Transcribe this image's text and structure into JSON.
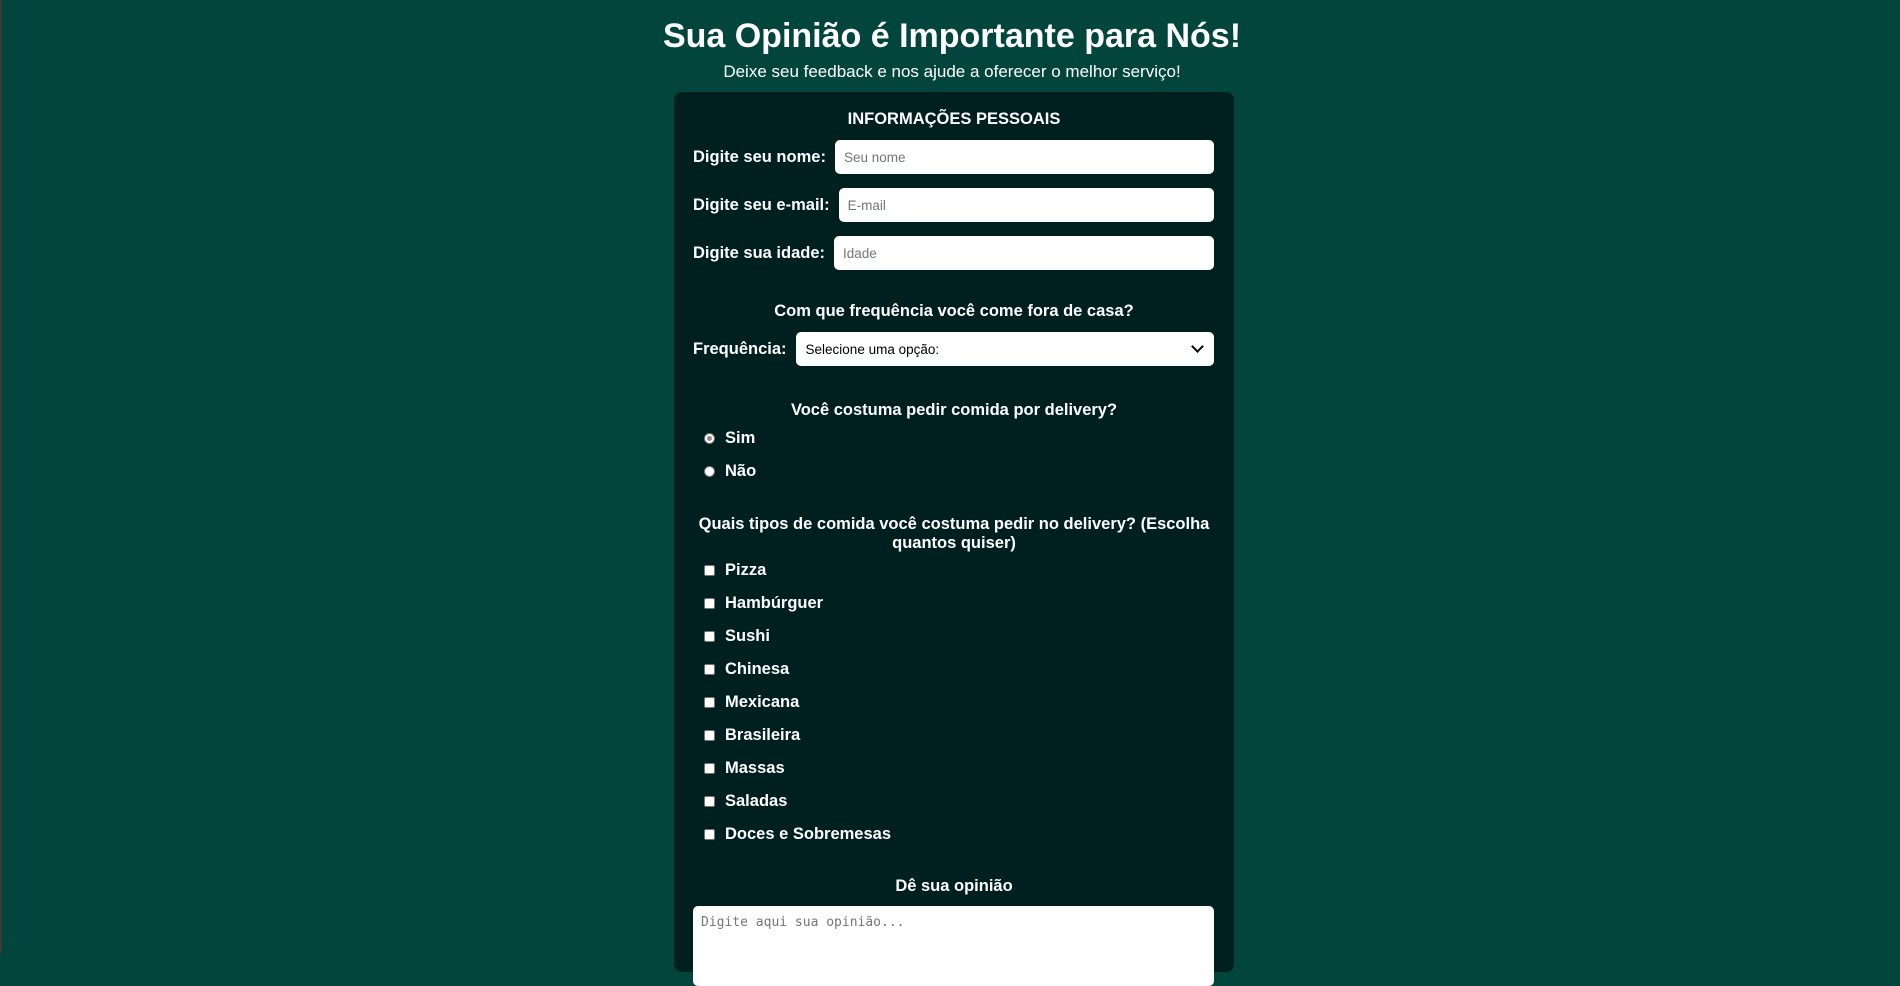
{
  "header": {
    "title": "Sua Opinião é Importante para Nós!",
    "subtitle": "Deixe seu feedback e nos ajude a oferecer o melhor serviço!"
  },
  "personal": {
    "section_title": "INFORMAÇÕES PESSOAIS",
    "name_label": "Digite seu nome:",
    "name_placeholder": "Seu nome",
    "email_label": "Digite seu e-mail:",
    "email_placeholder": "E-mail",
    "age_label": "Digite sua idade:",
    "age_placeholder": "Idade"
  },
  "frequency": {
    "question": "Com que frequência você come fora de casa?",
    "label": "Frequência:",
    "selected": "Selecione uma opção:"
  },
  "delivery": {
    "question": "Você costuma pedir comida por delivery?",
    "options": [
      "Sim",
      "Não"
    ]
  },
  "food_types": {
    "question": "Quais tipos de comida você costuma pedir no delivery? (Escolha quantos quiser)",
    "options": [
      "Pizza",
      "Hambúrguer",
      "Sushi",
      "Chinesa",
      "Mexicana",
      "Brasileira",
      "Massas",
      "Saladas",
      "Doces e Sobremesas"
    ]
  },
  "opinion": {
    "title": "Dê sua opinião",
    "placeholder": "Digite aqui sua opinião..."
  },
  "colors": {
    "page_background": "#01453c",
    "card_background": "#001f1f",
    "text": "#ffffff"
  }
}
